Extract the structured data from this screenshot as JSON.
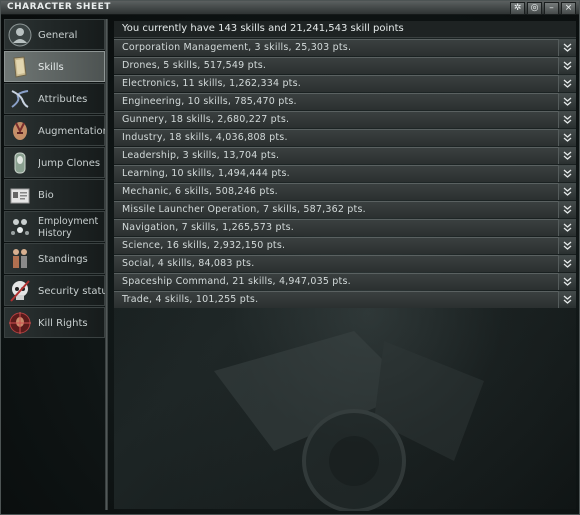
{
  "window": {
    "title": "CHARACTER SHEET"
  },
  "title_buttons": {
    "settings": "✲",
    "pin": "◎",
    "minimize": "–",
    "close": "×"
  },
  "sidebar": {
    "items": [
      {
        "label": "General",
        "icon": "portrait-icon"
      },
      {
        "label": "Skills",
        "icon": "skill-book-icon"
      },
      {
        "label": "Attributes",
        "icon": "dna-helix-icon"
      },
      {
        "label": "Augmentations",
        "icon": "augmented-head-icon"
      },
      {
        "label": "Jump Clones",
        "icon": "clone-vat-icon"
      },
      {
        "label": "Bio",
        "icon": "document-icon"
      },
      {
        "label": "Employment History",
        "icon": "employees-icon"
      },
      {
        "label": "Standings",
        "icon": "figures-icon"
      },
      {
        "label": "Security status",
        "icon": "skull-icon"
      },
      {
        "label": "Kill Rights",
        "icon": "target-head-icon"
      }
    ]
  },
  "skills": {
    "summary": "You currently have 143 skills and 21,241,543 skill points",
    "groups": [
      "Corporation Management, 3 skills, 25,303 pts.",
      "Drones, 5 skills, 517,549 pts.",
      "Electronics, 11 skills, 1,262,334 pts.",
      "Engineering, 10 skills, 785,470 pts.",
      "Gunnery, 18 skills, 2,680,227 pts.",
      "Industry, 18 skills, 4,036,808 pts.",
      "Leadership, 3 skills, 13,704 pts.",
      "Learning, 10 skills, 1,494,444 pts.",
      "Mechanic, 6 skills, 508,246 pts.",
      "Missile Launcher Operation, 7 skills, 587,362 pts.",
      "Navigation, 7 skills, 1,265,573 pts.",
      "Science, 16 skills, 2,932,150 pts.",
      "Social, 4 skills, 84,083 pts.",
      "Spaceship Command, 21 skills, 4,947,035 pts.",
      "Trade, 4 skills, 101,255 pts."
    ]
  }
}
